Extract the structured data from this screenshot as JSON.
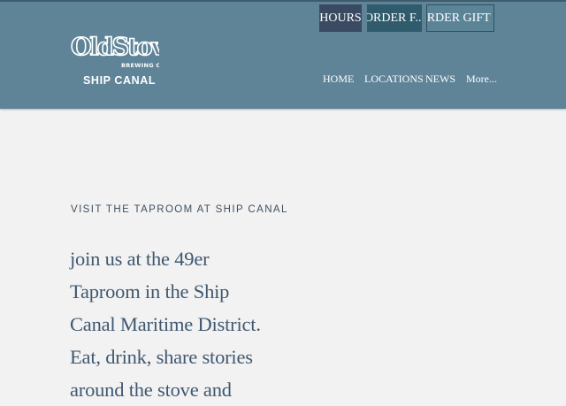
{
  "brand": {
    "logo_text": "OldStove",
    "logo_tagline": "BREWING CO",
    "location": "SHIP CANAL"
  },
  "top_buttons": {
    "hours": "HOURS",
    "order_food": "ORDER F...",
    "order_gift": "ORDER GIFT ..."
  },
  "nav": {
    "home": "HOME",
    "locations": "LOCATIONS",
    "news": "NEWS",
    "more": "More..."
  },
  "main": {
    "eyebrow": "VISIT THE TAPROOM AT SHIP CANAL",
    "body": "join us at the 49er Taproom in the Ship Canal Maritime District. Eat, drink, share stories around the stove and"
  },
  "colors": {
    "header_bg": "#5f8498",
    "page_bg": "#f2f2f2",
    "hours_btn": "#3a4a62",
    "order_btn": "#2f5b6c",
    "text_accent": "#3f5870"
  }
}
